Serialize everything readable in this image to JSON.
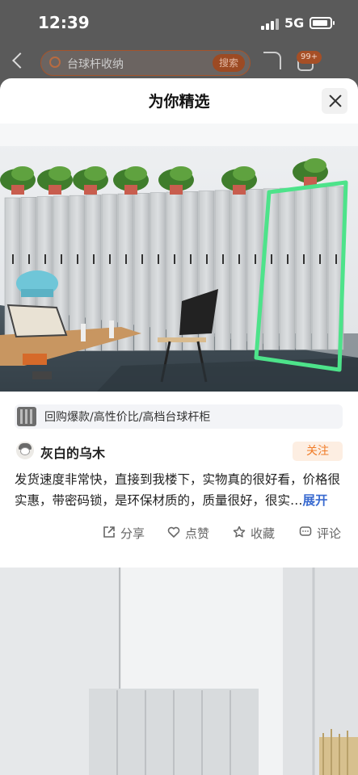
{
  "status_bar": {
    "time": "12:39",
    "network": "5G"
  },
  "background_page": {
    "search_query": "台球杆收纳",
    "search_button": "搜索",
    "cart_badge": "99+"
  },
  "sheet": {
    "title": "为你精选",
    "product": {
      "title": "回购爆款/高性价比/高档台球杆柜"
    },
    "author": {
      "name": "灰白的乌木",
      "follow_label": "关注"
    },
    "review": {
      "line1": "发货速度非常快，直接到我楼下，实物真的很好看，价格很",
      "line2": "实惠，带密码锁，是环保材质的，质量很好，很实…",
      "expand_label": "展开"
    },
    "actions": {
      "share": "分享",
      "like": "点赞",
      "collect": "收藏",
      "comment": "评论"
    }
  },
  "colors": {
    "accent_orange": "#f07c28",
    "follow_bg": "#fdeee2",
    "link_blue": "#3a6bd0",
    "highlight_green": "#4de38a"
  },
  "icons": [
    "close-icon",
    "share-icon",
    "like-icon",
    "collect-icon",
    "comment-icon",
    "search-icon",
    "back-icon",
    "cart-icon"
  ]
}
